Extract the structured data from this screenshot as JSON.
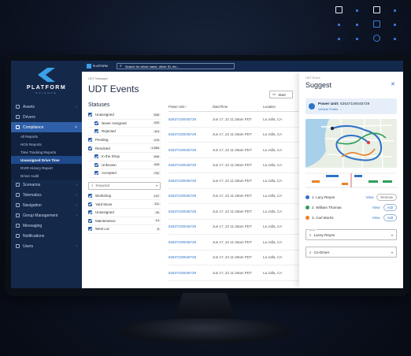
{
  "brand": {
    "name": "PLATFORM",
    "sub": "SCIENCE",
    "topbar_logo": "PLATFORM"
  },
  "search": {
    "placeholder": "Search for driver name, driver ID, etc..."
  },
  "sidebar": {
    "items": [
      {
        "label": "Assets",
        "icon": "assets-icon"
      },
      {
        "label": "Drivers",
        "icon": "driver-icon"
      },
      {
        "label": "Compliance",
        "icon": "compliance-icon",
        "active": true
      },
      {
        "label": "Scenarios",
        "icon": "scenario-icon"
      },
      {
        "label": "Telematics",
        "icon": "telematics-icon"
      },
      {
        "label": "Navigation",
        "icon": "navigation-icon"
      },
      {
        "label": "Group Management",
        "icon": "group-icon"
      },
      {
        "label": "Messaging",
        "icon": "message-icon"
      },
      {
        "label": "Notifications",
        "icon": "bell-icon"
      },
      {
        "label": "Users",
        "icon": "users-icon"
      }
    ],
    "compliance_sub": [
      "All Reports",
      "HOS Reports",
      "Time Tracking Reports",
      "Unassigned Drive Time",
      "DVIR History Report",
      "Driver Audit"
    ],
    "active_sub": "Unassigned Drive Time"
  },
  "page": {
    "breadcrumb": "UDT Manager",
    "title": "UDT Events",
    "start_label": "Start"
  },
  "statuses": {
    "title": "Statuses",
    "group1": [
      {
        "label": "Unassigned",
        "count": "535",
        "indent": false
      },
      {
        "label": "Never Assigned",
        "count": "425",
        "indent": true
      },
      {
        "label": "Rejected",
        "count": "110",
        "indent": true
      },
      {
        "label": "Pending",
        "count": "476",
        "indent": false
      },
      {
        "label": "Resolved",
        "count": "1,866",
        "indent": false
      },
      {
        "label": "In the Shop",
        "count": "646",
        "indent": true
      },
      {
        "label": "Unknown",
        "count": "428",
        "indent": true
      },
      {
        "label": "Accepted",
        "count": "792",
        "indent": true
      }
    ],
    "keyword_placeholder": "Keyword",
    "group2": [
      {
        "label": "Workshop",
        "count": "147"
      },
      {
        "label": "Yard Move",
        "count": "111"
      },
      {
        "label": "Unassigned",
        "count": "20"
      },
      {
        "label": "Maintenance",
        "count": "14"
      },
      {
        "label": "West Lot",
        "count": "8"
      }
    ]
  },
  "table": {
    "headers": {
      "power_unit": "Power Unit",
      "date_time": "Date/Time",
      "location": "Location"
    },
    "rows": [
      {
        "unit": "62637100045729",
        "date": "Jun 17, 22 11:26am PDT",
        "loc": "La Jolla, CA"
      },
      {
        "unit": "62637100045729",
        "date": "Jun 17, 22 11:26am PDT",
        "loc": "La Jolla, CA"
      },
      {
        "unit": "62637100045729",
        "date": "Jun 17, 22 11:26am PDT",
        "loc": "La Jolla, CA"
      },
      {
        "unit": "62637100045729",
        "date": "Jun 17, 22 11:26am PDT",
        "loc": "La Jolla, CA"
      },
      {
        "unit": "62637100045729",
        "date": "Jun 17, 22 11:26am PDT",
        "loc": "La Jolla, CA"
      },
      {
        "unit": "62637100045729",
        "date": "Jun 17, 22 11:26am PDT",
        "loc": "La Jolla, CA"
      },
      {
        "unit": "62637100045729",
        "date": "Jun 17, 22 11:26am PDT",
        "loc": "La Jolla, CA"
      },
      {
        "unit": "62637100045729",
        "date": "Jun 17, 22 11:26am PDT",
        "loc": "La Jolla, CA"
      },
      {
        "unit": "62637100045729",
        "date": "Jun 17, 22 11:26am PDT",
        "loc": "La Jolla, CA"
      },
      {
        "unit": "62637100045729",
        "date": "Jun 17, 22 11:26am PDT",
        "loc": "La Jolla, CA"
      },
      {
        "unit": "62637100045729",
        "date": "Jun 17, 22 11:26am PDT",
        "loc": "La Jolla, CA"
      }
    ]
  },
  "panel": {
    "breadcrumb": "UDT Event",
    "title": "Suggest",
    "power_unit_label": "Power Unit:",
    "power_unit_value": "62637100045729",
    "vehicle_profile": "Vehicle Profile",
    "drivers": [
      {
        "label": "1. Lacy Reyes",
        "color": "#2f72c8",
        "view": "View",
        "action": "Remove"
      },
      {
        "label": "2. William Thomas",
        "color": "#2e9e5b",
        "view": "View",
        "action": "Add"
      },
      {
        "label": "3. Carl Morris",
        "color": "#e8832a",
        "view": "View",
        "action": "Add"
      }
    ],
    "driver_select_label": "Driver",
    "driver_select_value": "Lacey Reyes",
    "codriver_placeholder": "Co-Driver"
  }
}
